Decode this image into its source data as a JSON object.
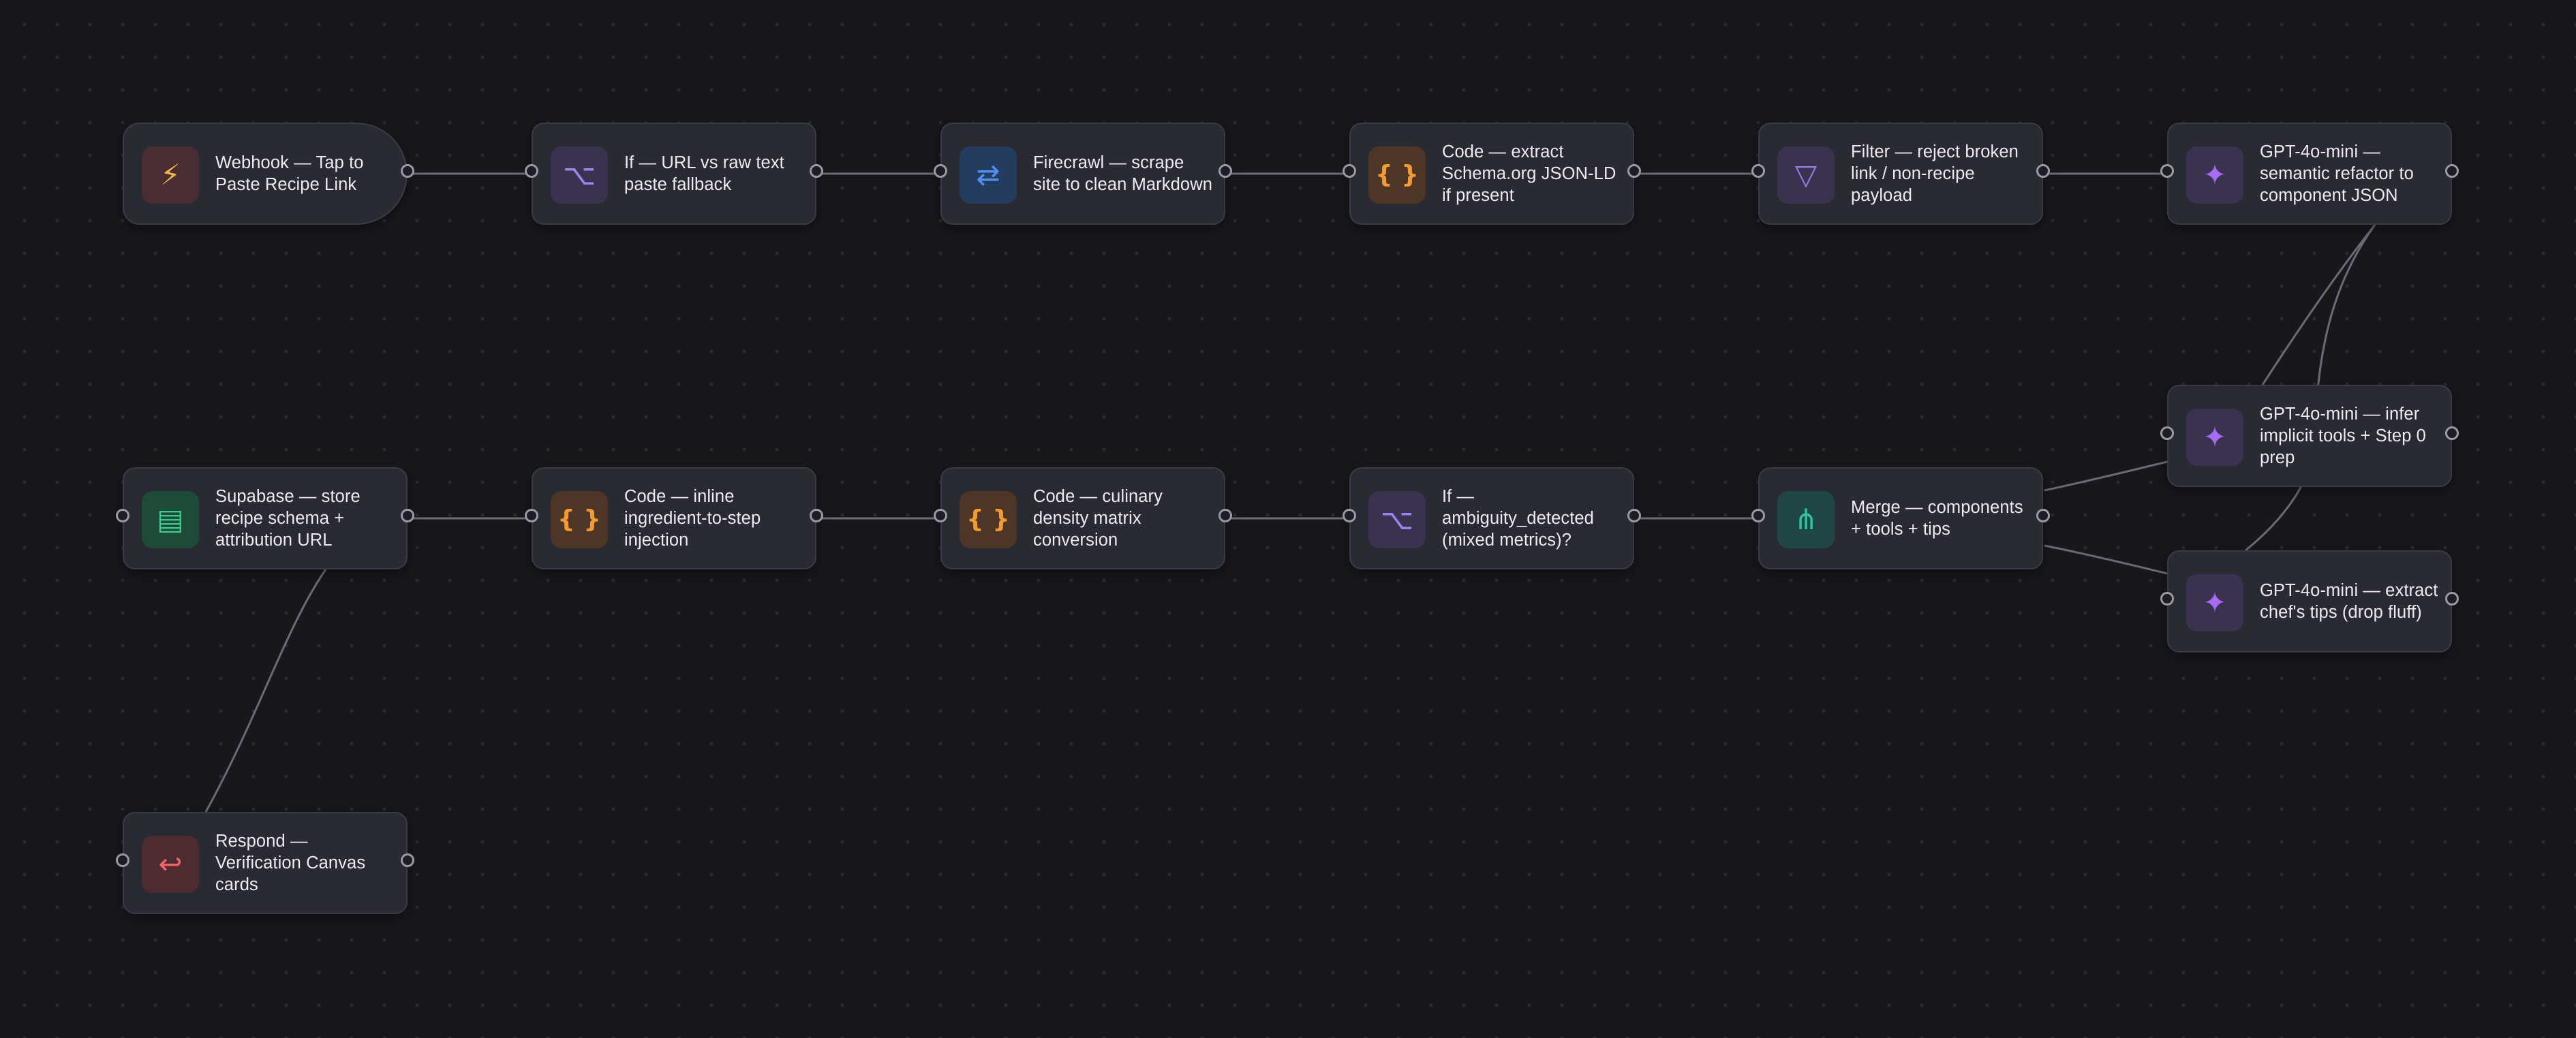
{
  "canvas": {
    "background": "#17171c",
    "edge_color": "#6b6b75"
  },
  "nodes": [
    {
      "id": "webhook",
      "label": "Webhook — Tap to Paste Recipe Link",
      "icon": "lightning-icon",
      "glyph": "⚡",
      "color": "#f0b847"
    },
    {
      "id": "if_url",
      "label": "If — URL vs raw text paste fallback",
      "icon": "branch-icon",
      "glyph": "⌥",
      "color": "#9d84f0"
    },
    {
      "id": "firecrawl",
      "label": "Firecrawl — scrape site to clean Markdown",
      "icon": "swap-arrows-icon",
      "glyph": "⇄",
      "color": "#4f8ff0"
    },
    {
      "id": "code_schema",
      "label": "Code — extract Schema.org JSON-LD if present",
      "icon": "braces-icon",
      "glyph": "{ }",
      "color": "#f59a2e"
    },
    {
      "id": "filter",
      "label": "Filter — reject broken link / non-recipe payload",
      "icon": "filter-triangle-icon",
      "glyph": "▽",
      "color": "#8f7ce6"
    },
    {
      "id": "gpt_refactor",
      "label": "GPT-4o-mini — semantic refactor to component JSON",
      "icon": "sparkle-icon",
      "glyph": "✦",
      "color": "#a76bf5"
    },
    {
      "id": "gpt_tools",
      "label": "GPT-4o-mini — infer implicit tools + Step 0 prep",
      "icon": "sparkle-icon",
      "glyph": "✦",
      "color": "#a76bf5"
    },
    {
      "id": "gpt_tips",
      "label": "GPT-4o-mini — extract chef's tips (drop fluff)",
      "icon": "sparkle-icon",
      "glyph": "✦",
      "color": "#a76bf5"
    },
    {
      "id": "merge",
      "label": "Merge — components + tools + tips",
      "icon": "merge-icon",
      "glyph": "⋔",
      "color": "#2ec4a0"
    },
    {
      "id": "if_ambiguity",
      "label": "If — ambiguity_detected (mixed metrics)?",
      "icon": "branch-icon",
      "glyph": "⌥",
      "color": "#9d84f0"
    },
    {
      "id": "code_density",
      "label": "Code — culinary density matrix conversion",
      "icon": "braces-icon",
      "glyph": "{ }",
      "color": "#f59a2e"
    },
    {
      "id": "code_inline",
      "label": "Code — inline ingredient-to-step injection",
      "icon": "braces-icon",
      "glyph": "{ }",
      "color": "#f59a2e"
    },
    {
      "id": "supabase",
      "label": "Supabase — store recipe schema + attribution URL",
      "icon": "database-icon",
      "glyph": "▤",
      "color": "#3ec98a"
    },
    {
      "id": "respond",
      "label": "Respond — Verification Canvas cards",
      "icon": "return-arrow-icon",
      "glyph": "↩",
      "color": "#f2646a"
    }
  ],
  "connections": [
    {
      "from": "webhook",
      "to": "if_url"
    },
    {
      "from": "if_url",
      "to": "firecrawl"
    },
    {
      "from": "firecrawl",
      "to": "code_schema"
    },
    {
      "from": "code_schema",
      "to": "filter"
    },
    {
      "from": "filter",
      "to": "gpt_refactor"
    },
    {
      "from": "gpt_refactor",
      "to": "gpt_tools"
    },
    {
      "from": "gpt_refactor",
      "to": "gpt_tips"
    },
    {
      "from": "gpt_tools",
      "to": "merge"
    },
    {
      "from": "gpt_tips",
      "to": "merge"
    },
    {
      "from": "merge",
      "to": "if_ambiguity"
    },
    {
      "from": "if_ambiguity",
      "to": "code_density"
    },
    {
      "from": "code_density",
      "to": "code_inline"
    },
    {
      "from": "code_inline",
      "to": "supabase"
    },
    {
      "from": "supabase",
      "to": "respond"
    }
  ]
}
